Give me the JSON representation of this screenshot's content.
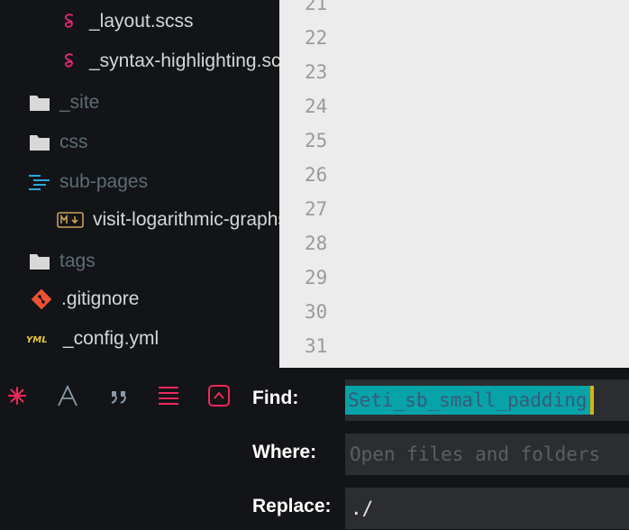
{
  "sidebar": {
    "items": [
      {
        "label": "_layout.scss",
        "icon": "sass-icon"
      },
      {
        "label": "_syntax-highlighting.scss",
        "icon": "sass-icon"
      },
      {
        "label": "_site",
        "icon": "folder-icon"
      },
      {
        "label": "css",
        "icon": "folder-icon"
      },
      {
        "label": "sub-pages",
        "icon": "folder-open-icon"
      },
      {
        "label": "visit-logarithmic-graphs.md",
        "icon": "markdown-icon"
      },
      {
        "label": "tags",
        "icon": "folder-icon"
      },
      {
        "label": ".gitignore",
        "icon": "git-icon"
      },
      {
        "label": "_config.yml",
        "icon": "yml-icon"
      }
    ]
  },
  "editor": {
    "line_numbers": [
      "21",
      "22",
      "23",
      "24",
      "25",
      "26",
      "27",
      "28",
      "29",
      "30",
      "31"
    ]
  },
  "findbar": {
    "find_label": "Find:",
    "where_label": "Where:",
    "replace_label": "Replace:",
    "find_value": "Seti_sb_small_padding",
    "where_placeholder": "Open files and folders",
    "replace_value": "./",
    "tools": [
      "regex-icon",
      "case-sensitive-icon",
      "whole-word-icon",
      "wrap-icon",
      "in-selection-icon"
    ]
  },
  "colors": {
    "accent": "#f0285a",
    "find_highlight": "#06a3a8",
    "caret": "#d8b40c",
    "editor_bg": "#ececec"
  }
}
